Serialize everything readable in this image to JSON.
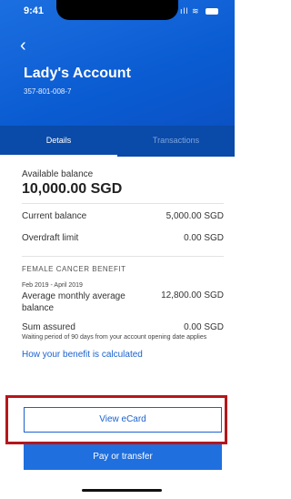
{
  "status_bar": {
    "time": "9:41",
    "icons": "ıll ≋"
  },
  "header": {
    "back_glyph": "‹",
    "title": "Lady's Account",
    "account_number": "357-801-008-7"
  },
  "tabs": [
    {
      "label": "Details",
      "active": true
    },
    {
      "label": "Transactions",
      "active": false
    }
  ],
  "balances": {
    "available_label": "Available balance",
    "available_value": "10,000.00 SGD",
    "current_label": "Current balance",
    "current_value": "5,000.00 SGD",
    "overdraft_label": "Overdraft limit",
    "overdraft_value": "0.00 SGD"
  },
  "benefit": {
    "heading": "FEMALE CANCER BENEFIT",
    "period": "Feb 2019 - April 2019",
    "avg_label": "Average monthly average balance",
    "avg_value": "12,800.00 SGD",
    "sum_label": "Sum assured",
    "sum_value": "0.00 SGD",
    "waiting_note": "Waiting period of 90 days from your account opening date applies",
    "calc_link": "How your benefit is calculated"
  },
  "actions": {
    "ecard_label": "View eCard",
    "pay_label": "Pay or transfer"
  },
  "colors": {
    "primary": "#1f6fde",
    "header": "#0a5bd1",
    "highlight": "#b4161b"
  }
}
